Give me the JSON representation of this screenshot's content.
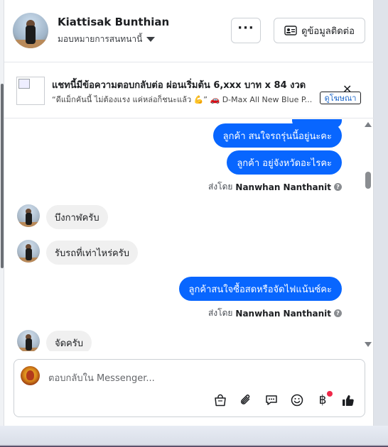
{
  "header": {
    "name": "Kiattisak Bunthian",
    "subtitle": "มอบหมายการสนทนานี้",
    "more_label": "···",
    "contact_label": "ดูข้อมูลติดต่อ"
  },
  "ad": {
    "title": "แชทนี้มีข้อความตอบกลับต่อ ผ่อนเริ่มต้น 6,xxx บาท x 84 งวด",
    "description": "“ดีแม็กคันนี้ ไม่ต้องแรง แค่หล่อก็ชนะแล้ว 💪” 🚗 D-Max All New Blue P...",
    "link_label": "ดูโฆษณา",
    "close_label": "✕"
  },
  "messages": [
    {
      "dir": "out",
      "text": "ลูกค้า  สนใจรถรุ่นนี้อยู่นะคะ"
    },
    {
      "dir": "out",
      "text": "ลูกค้า  อยู่จังหวัดอะไรคะ"
    },
    {
      "dir": "meta",
      "prefix": "ส่งโดย",
      "sender": "Nanwhan Nanthanit"
    },
    {
      "dir": "in",
      "text": "บึงกาฬครับ"
    },
    {
      "dir": "in",
      "text": "รับรถที่เท่าไหร่ครับ"
    },
    {
      "dir": "out",
      "text": "ลูกค้าสนใจซื้อสดหรือจัดไฟแน้นซ์คะ"
    },
    {
      "dir": "meta",
      "prefix": "ส่งโดย",
      "sender": "Nanwhan Nanthanit"
    },
    {
      "dir": "in",
      "text": "จัดครับ"
    }
  ],
  "composer": {
    "placeholder": "ตอบกลับใน Messenger...",
    "baht_symbol": "฿"
  },
  "colors": {
    "accent": "#0866ff",
    "incoming_bubble": "#f0f0f0",
    "notification": "#f02849"
  }
}
